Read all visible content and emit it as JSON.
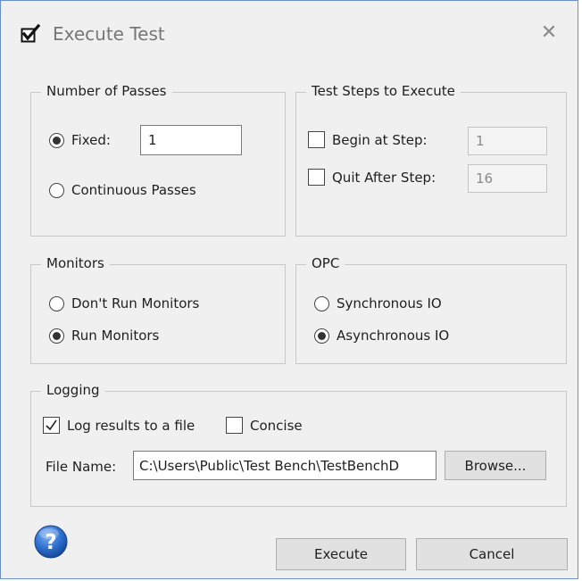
{
  "window": {
    "title": "Execute Test",
    "title_icon": "checkbox-checked-icon",
    "close_icon": "close-icon",
    "close_glyph": "✕"
  },
  "passes": {
    "legend": "Number of Passes",
    "fixed_label": "Fixed:",
    "fixed_value": "1",
    "fixed_selected": true,
    "continuous_label": "Continuous Passes",
    "continuous_selected": false
  },
  "steps": {
    "legend": "Test Steps to Execute",
    "begin_label": "Begin at Step:",
    "begin_checked": false,
    "begin_value": "1",
    "quit_label": "Quit After Step:",
    "quit_checked": false,
    "quit_value": "16"
  },
  "monitors": {
    "legend": "Monitors",
    "dont_run_label": "Don't Run Monitors",
    "dont_run_selected": false,
    "run_label": "Run Monitors",
    "run_selected": true
  },
  "opc": {
    "legend": "OPC",
    "sync_label": "Synchronous IO",
    "sync_selected": false,
    "async_label": "Asynchronous IO",
    "async_selected": true
  },
  "logging": {
    "legend": "Logging",
    "log_label": "Log results to a file",
    "log_checked": true,
    "concise_label": "Concise",
    "concise_checked": false,
    "filename_label": "File Name:",
    "filename_value": "C:\\Users\\Public\\Test Bench\\TestBenchD",
    "browse_label": "Browse..."
  },
  "footer": {
    "help_icon": "help-question-icon",
    "execute_label": "Execute",
    "cancel_label": "Cancel"
  }
}
